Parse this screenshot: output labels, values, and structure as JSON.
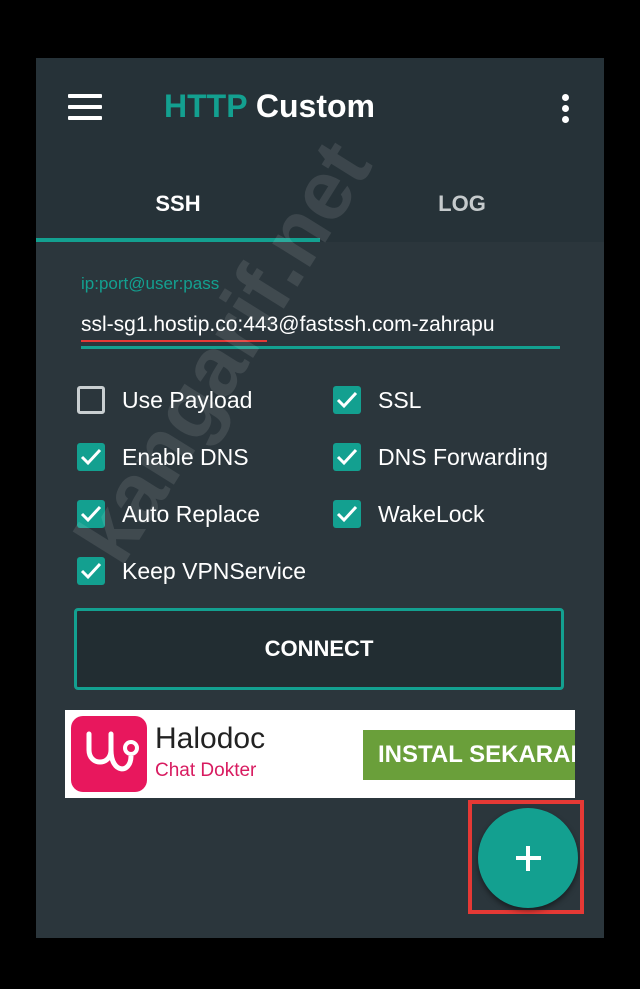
{
  "app": {
    "title_accent": "HTTP",
    "title_rest": "Custom"
  },
  "tabs": [
    {
      "label": "SSH",
      "active": true
    },
    {
      "label": "LOG",
      "active": false
    }
  ],
  "input": {
    "label": "ip:port@user:pass",
    "value": "ssl-sg1.hostip.co:443@fastssh.com-zahrapu"
  },
  "options": [
    {
      "label": "Use Payload",
      "checked": false
    },
    {
      "label": "SSL",
      "checked": true
    },
    {
      "label": "Enable DNS",
      "checked": true
    },
    {
      "label": "DNS Forwarding",
      "checked": true
    },
    {
      "label": "Auto Replace",
      "checked": true
    },
    {
      "label": "WakeLock",
      "checked": true
    },
    {
      "label": "Keep VPNService",
      "checked": true
    }
  ],
  "connect_label": "CONNECT",
  "ad": {
    "name": "Halodoc",
    "subtitle": "Chat Dokter",
    "cta": "INSTAL SEKARANG"
  },
  "fab_icon": "plus-icon",
  "watermark": "kangarif.net",
  "colors": {
    "accent": "#13a090",
    "background": "#263238",
    "highlight": "#e53935",
    "ad_logo": "#e8175d",
    "ad_cta": "#6a9f3a"
  }
}
